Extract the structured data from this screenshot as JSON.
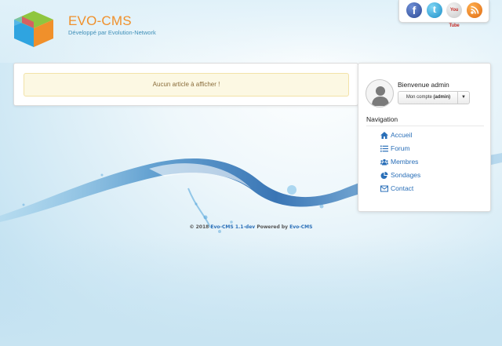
{
  "header": {
    "brand_title": "EVO-CMS",
    "brand_subtitle": "Développé par Evolution-Network",
    "logo_icon": "cube-logo"
  },
  "social": {
    "facebook": {
      "glyph": "f",
      "icon": "facebook-icon"
    },
    "twitter": {
      "glyph": "t",
      "icon": "twitter-icon"
    },
    "youtube": {
      "glyph": "You Tube",
      "icon": "youtube-icon"
    },
    "rss": {
      "icon": "rss-icon"
    }
  },
  "main": {
    "alert_text": "Aucun article à afficher !"
  },
  "sidebar": {
    "welcome": "Bienvenue admin",
    "account_label": "Mon compte",
    "account_user": "(admin)",
    "navigation_title": "Navigation",
    "nav_items": [
      {
        "label": "Accueil",
        "icon": "home-icon"
      },
      {
        "label": "Forum",
        "icon": "list-icon"
      },
      {
        "label": "Membres",
        "icon": "users-icon"
      },
      {
        "label": "Sondages",
        "icon": "pie-chart-icon"
      },
      {
        "label": "Contact",
        "icon": "envelope-icon"
      }
    ]
  },
  "footer": {
    "prefix": "© 2018",
    "product": "Evo-CMS 1.1-dev",
    "powered_label": "Powered by",
    "powered_link": "Evo-CMS"
  },
  "colors": {
    "brand_orange": "#f0902b",
    "link_blue": "#2a6fb8",
    "alert_bg": "#fcf8e3",
    "alert_text": "#8a6d3b"
  }
}
